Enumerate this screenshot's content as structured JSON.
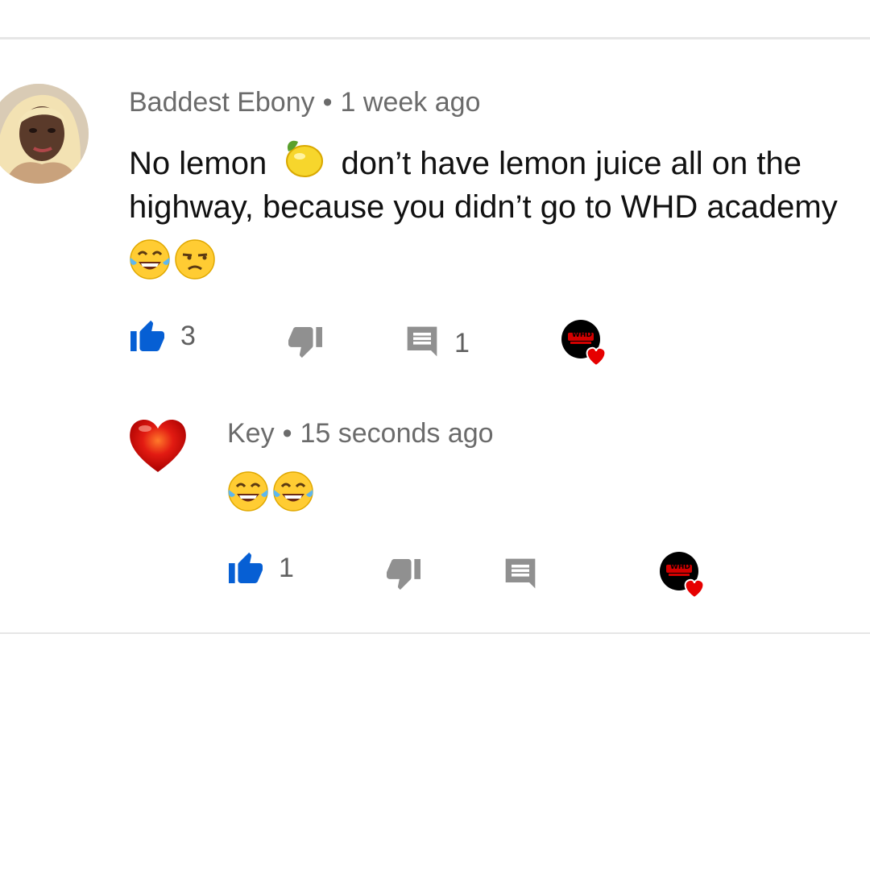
{
  "comment": {
    "author": "Baddest Ebony",
    "separator": "•",
    "time": "1 week ago",
    "text_line1_a": "No lemon",
    "text_line1_b": "don’t have lemon juice all on the",
    "text_line2": "highway, because you didn’t go to WHD academy",
    "emoji_icons": [
      "lemon-emoji",
      "tears-of-joy-emoji",
      "unamused-emoji"
    ],
    "likes": "3",
    "replies": "1"
  },
  "reply": {
    "author": "Key",
    "separator": "•",
    "time": "15 seconds ago",
    "emoji_icons": [
      "tears-of-joy-emoji",
      "tears-of-joy-emoji"
    ],
    "likes": "1"
  },
  "creator_heart": {
    "logo_text": "WHD",
    "icon": "heart-icon"
  },
  "colors": {
    "like_blue": "#065fd4",
    "icon_gray": "#909090",
    "heart_red": "#e60000"
  }
}
